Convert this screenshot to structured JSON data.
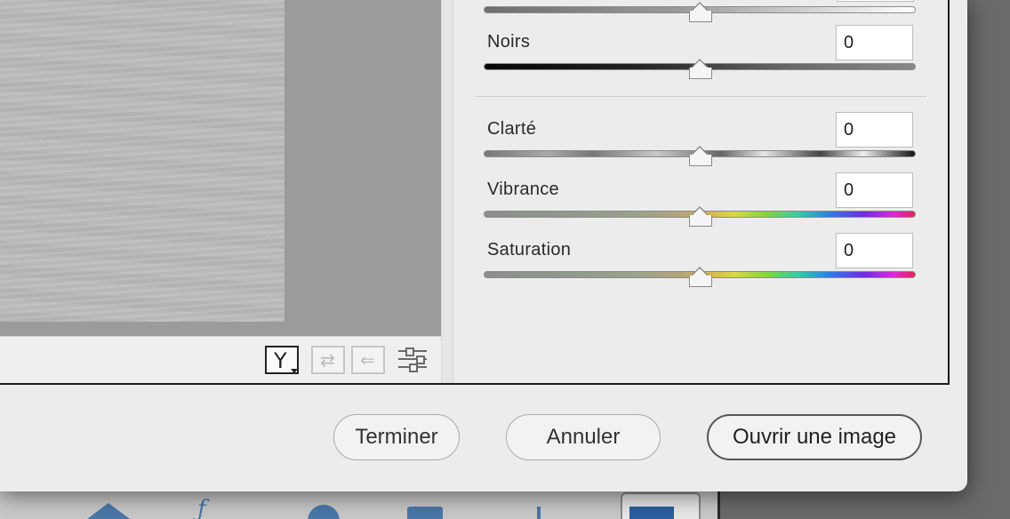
{
  "window": {
    "preview": {
      "toolbar": {
        "view_toggle_label": "Y",
        "swap_label": "⇄",
        "copy_label": "⇐"
      }
    },
    "panel": {
      "sliders": [
        {
          "id": "top",
          "label": "",
          "value": "",
          "position": 0.5
        },
        {
          "id": "noirs",
          "label": "Noirs",
          "value": "0",
          "position": 0.5
        },
        {
          "id": "clarte",
          "label": "Clarté",
          "value": "0",
          "position": 0.5
        },
        {
          "id": "vibrance",
          "label": "Vibrance",
          "value": "0",
          "position": 0.5
        },
        {
          "id": "saturation",
          "label": "Saturation",
          "value": "0",
          "position": 0.5
        }
      ]
    },
    "footer": {
      "terminer_label": "Terminer",
      "annuler_label": "Annuler",
      "ouvrir_label": "Ouvrir une image"
    }
  },
  "colors": {
    "dialog_bg": "#ececec",
    "frame_border": "#1c1c1c",
    "preview_bg": "#9b9b9b",
    "accent_background_app": "#4a78a8"
  }
}
